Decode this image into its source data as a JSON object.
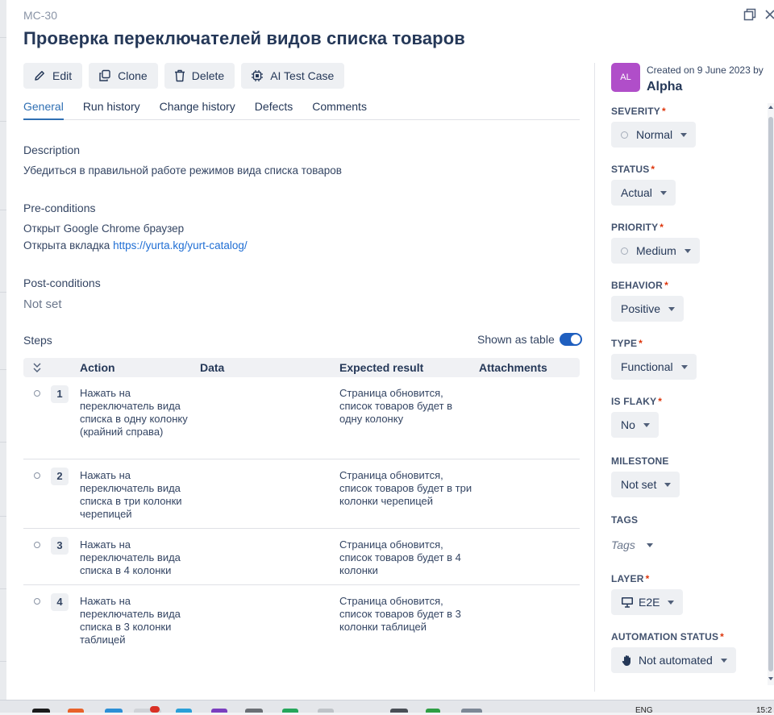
{
  "case": {
    "id": "MC-30",
    "title": "Проверка переключателей видов списка товаров"
  },
  "toolbar": {
    "edit": "Edit",
    "clone": "Clone",
    "delete": "Delete",
    "ai": "AI Test Case"
  },
  "tabs": [
    "General",
    "Run history",
    "Change history",
    "Defects",
    "Comments"
  ],
  "description": {
    "label": "Description",
    "text": "Убедиться в правильной работе режимов вида списка товаров"
  },
  "preconditions": {
    "label": "Pre-conditions",
    "line1": "Открыт Google Chrome браузер",
    "line2_prefix": "Открыта вкладка",
    "line2_link": "https://yurta.kg/yurt-catalog/"
  },
  "postconditions": {
    "label": "Post-conditions",
    "value": "Not set"
  },
  "steps": {
    "label": "Steps",
    "toggle_label": "Shown as table",
    "toggle_on": true,
    "columns": [
      "Action",
      "Data",
      "Expected result",
      "Attachments"
    ],
    "rows": [
      {
        "num": "1",
        "action": "Нажать на переключатель вида списка в одну колонку (крайний справа)",
        "data": "",
        "expected": "Страница обновится, список товаров будет в одну колонку"
      },
      {
        "num": "2",
        "action": "Нажать на переключатель вида списка в три колонки черепицей",
        "data": "",
        "expected": "Страница обновится, список товаров будет в три колонки черепицей"
      },
      {
        "num": "3",
        "action": "Нажать на переключатель вида списка в 4 колонки",
        "data": "",
        "expected": "Страница обновится, список товаров будет в 4 колонки"
      },
      {
        "num": "4",
        "action": "Нажать на переключатель вида списка в 3 колонки таблицей",
        "data": "",
        "expected": "Страница обновится, список товаров будет в 3 колонки таблицей"
      }
    ]
  },
  "sidebar": {
    "avatar_initials": "AL",
    "avatar_color": "#b04ec9",
    "created": "Created on 9 June 2023 by",
    "author": "Alpha",
    "fields": {
      "severity": {
        "label": "SEVERITY",
        "value": "Normal"
      },
      "status": {
        "label": "STATUS",
        "value": "Actual"
      },
      "priority": {
        "label": "PRIORITY",
        "value": "Medium"
      },
      "behavior": {
        "label": "BEHAVIOR",
        "value": "Positive"
      },
      "type": {
        "label": "TYPE",
        "value": "Functional"
      },
      "is_flaky": {
        "label": "IS FLAKY",
        "value": "No"
      },
      "milestone": {
        "label": "MILESTONE",
        "value": "Not set"
      },
      "tags": {
        "label": "TAGS",
        "value": "Tags"
      },
      "layer": {
        "label": "LAYER",
        "value": "E2E"
      },
      "automation_status": {
        "label": "AUTOMATION STATUS",
        "value": "Not automated"
      }
    }
  },
  "taskbar": {
    "lang": "ENG",
    "time": "15:2"
  },
  "colors": {
    "accent": "#2f6fb3",
    "link": "#1f6ed4",
    "required": "#de350b",
    "toggle": "#1f5fbf"
  }
}
